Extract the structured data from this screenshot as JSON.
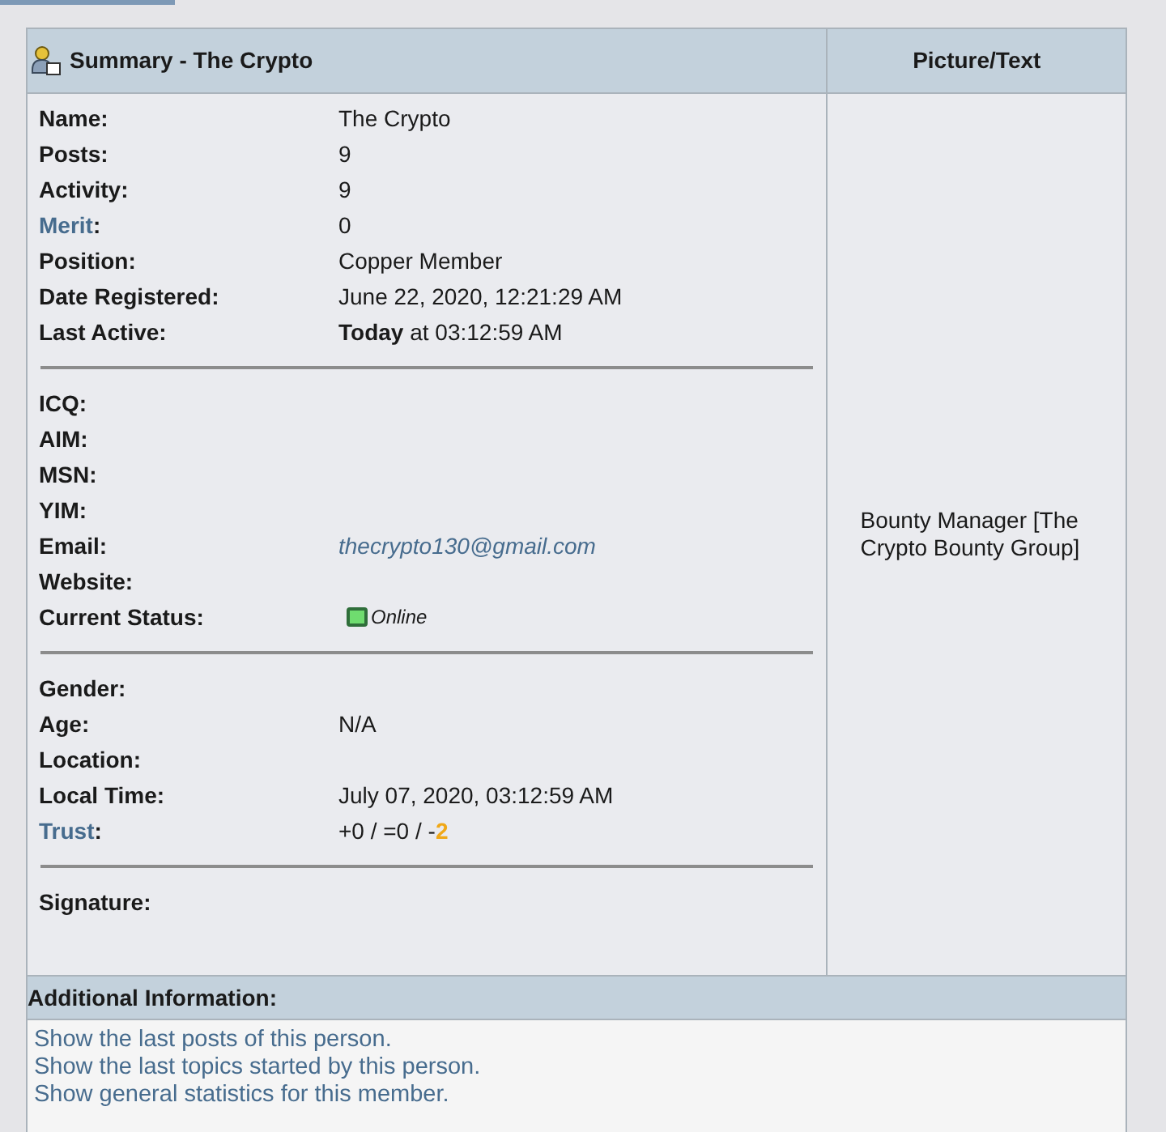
{
  "summary": {
    "title": "Summary - The Crypto",
    "side_heading": "Picture/Text",
    "groups": [
      [
        {
          "label": "Name:",
          "label_is_link": false,
          "kind": "text",
          "value": "The Crypto"
        },
        {
          "label": "Posts:",
          "label_is_link": false,
          "kind": "text",
          "value": "9"
        },
        {
          "label": "Activity:",
          "label_is_link": false,
          "kind": "text",
          "value": "9"
        },
        {
          "label": "Merit",
          "label_suffix": ":",
          "label_is_link": true,
          "kind": "text",
          "value": "0"
        },
        {
          "label": "Position:",
          "label_is_link": false,
          "kind": "text",
          "value": "Copper Member"
        },
        {
          "label": "Date Registered:",
          "label_is_link": false,
          "kind": "text",
          "value": "June 22, 2020, 12:21:29 AM"
        },
        {
          "label": "Last Active:",
          "label_is_link": false,
          "kind": "text",
          "value": "**Today** at 03:12:59 AM"
        }
      ],
      [
        {
          "label": "ICQ:",
          "label_is_link": false,
          "kind": "text"
        },
        {
          "label": "AIM:",
          "label_is_link": false,
          "kind": "text"
        },
        {
          "label": "MSN:",
          "label_is_link": false,
          "kind": "text"
        },
        {
          "label": "YIM:",
          "label_is_link": false,
          "kind": "text"
        },
        {
          "label": "Email:",
          "label_is_link": false,
          "kind": "email",
          "value": "thecrypto130@gmail.com"
        },
        {
          "label": "Website:",
          "label_is_link": false,
          "kind": "text"
        },
        {
          "label": "Current Status:",
          "label_is_link": false,
          "kind": "status",
          "value": "Online",
          "online": true
        }
      ],
      [
        {
          "label": "Gender:",
          "label_is_link": false,
          "kind": "text"
        },
        {
          "label": "Age:",
          "label_is_link": false,
          "kind": "text",
          "value": "N/A"
        },
        {
          "label": "Location:",
          "label_is_link": false,
          "kind": "text"
        },
        {
          "label": "Local Time:",
          "label_is_link": false,
          "kind": "text",
          "value": "July 07, 2020, 03:12:59 AM"
        },
        {
          "label": "Trust",
          "label_suffix": ":",
          "label_is_link": true,
          "kind": "trust",
          "value": "+0 / =0 / -",
          "flag": "2"
        }
      ],
      [
        {
          "label": "Signature:",
          "label_is_link": false,
          "kind": "text"
        }
      ]
    ],
    "side_text": "Bounty Manager [The Crypto Bounty Group]"
  },
  "additional": {
    "heading": "Additional Information:",
    "links": [
      "Show the last posts of this person.",
      "Show the last topics started by this person.",
      "Show general statistics for this member."
    ]
  }
}
